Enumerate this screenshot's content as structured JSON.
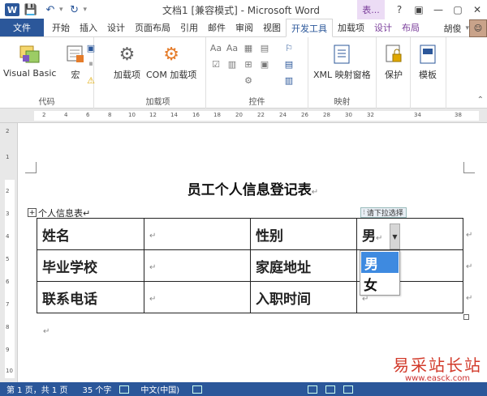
{
  "window": {
    "app_icon": "W",
    "title": "文档1 [兼容模式] - Microsoft Word",
    "context_tab_title": "表...",
    "controls": [
      "?",
      "▣",
      "—",
      "▢",
      "✕"
    ]
  },
  "qat": {
    "save": "💾",
    "undo": "↶",
    "redo": "↻",
    "more": "▾"
  },
  "tabs": {
    "file": "文件",
    "items": [
      "开始",
      "插入",
      "设计",
      "页面布局",
      "引用",
      "邮件",
      "审阅",
      "视图",
      "开发工具",
      "加载项",
      "设计",
      "布局"
    ],
    "active_index": 8,
    "context_start_index": 10
  },
  "user": {
    "name": "胡俊",
    "expand": "▾"
  },
  "ribbon": {
    "code": {
      "label": "代码",
      "vba": "Visual Basic",
      "macro": "宏"
    },
    "addins": {
      "label": "加载项",
      "addin": "加载项",
      "com": "COM 加载项"
    },
    "controls": {
      "label": "控件",
      "small_icons": [
        "Aa",
        "Aa",
        "▦",
        "▤",
        "☑",
        "▥",
        "⊞",
        "▣",
        "⚙",
        "⚐"
      ]
    },
    "mapping": {
      "label": "映射",
      "xml": "XML 映射窗格"
    },
    "protect": {
      "label": "保护"
    },
    "template": {
      "label": "模板"
    },
    "collapse": "⌃"
  },
  "ruler": {
    "h_numbers": [
      "2",
      "4",
      "6",
      "8",
      "10",
      "12",
      "14",
      "16",
      "18",
      "20",
      "22",
      "24",
      "26",
      "28",
      "30",
      "32",
      "34",
      "38"
    ],
    "v_numbers": [
      "2",
      "1",
      "2",
      "3",
      "4",
      "5",
      "6",
      "7",
      "8",
      "9",
      "10"
    ]
  },
  "document": {
    "heading": "员工个人信息登记表",
    "para_mark": "↵",
    "table_caption": "个人信息表↵",
    "table": [
      [
        "姓名",
        "",
        "性别",
        "男"
      ],
      [
        "毕业学校",
        "",
        "家庭地址",
        ""
      ],
      [
        "联系电话",
        "",
        "入职时间",
        ""
      ]
    ],
    "content_control": {
      "title": "请下拉选择",
      "options": [
        "男",
        "女"
      ],
      "selected": "男"
    }
  },
  "watermark": {
    "logo": "易采站长站",
    "url": "www.easck.com"
  },
  "status": {
    "page": "第 1 页，共 1 页",
    "words": "35 个字",
    "language": "中文(中国)"
  }
}
